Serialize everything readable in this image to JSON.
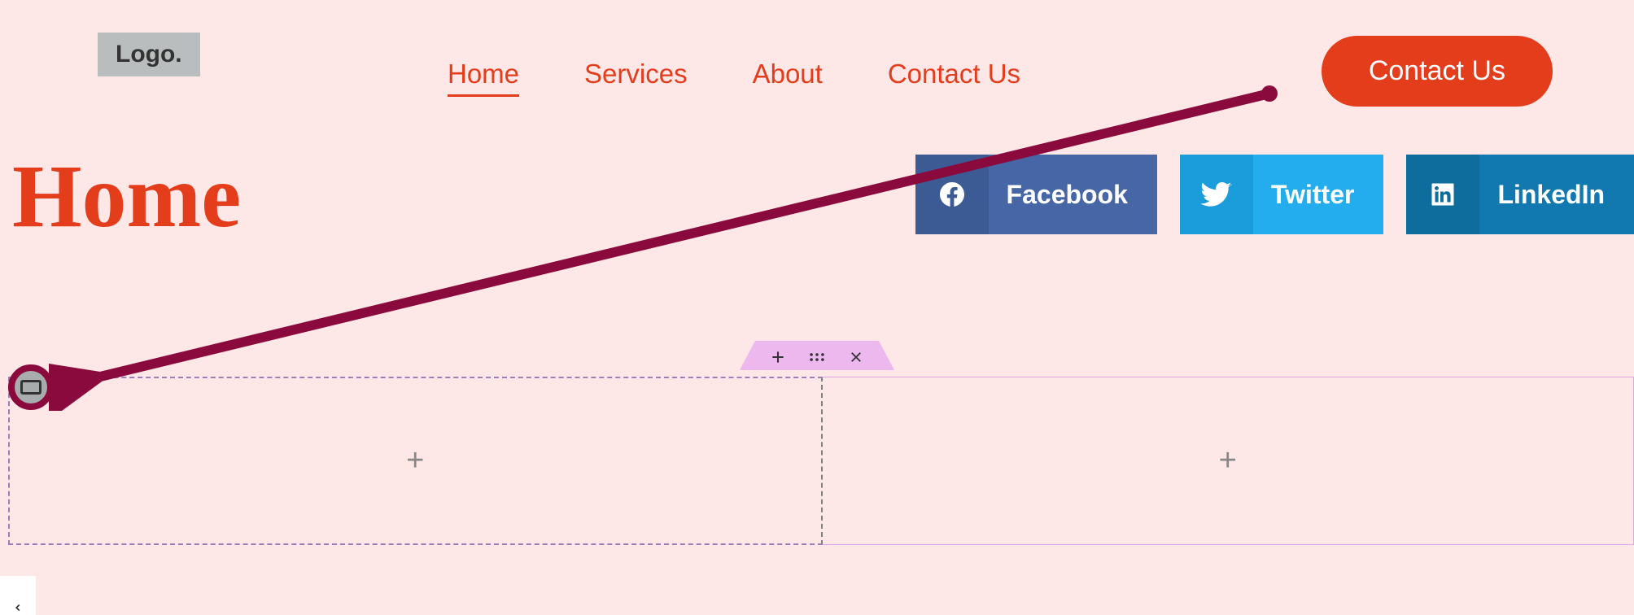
{
  "header": {
    "logo_text": "Logo.",
    "nav_items": [
      "Home",
      "Services",
      "About",
      "Contact Us"
    ],
    "active_nav_index": 0,
    "cta_label": "Contact Us"
  },
  "page": {
    "title": "Home"
  },
  "social": [
    {
      "name": "Facebook",
      "icon": "facebook"
    },
    {
      "name": "Twitter",
      "icon": "twitter"
    },
    {
      "name": "LinkedIn",
      "icon": "linkedin"
    }
  ],
  "editor": {
    "plus_tooltip": "+",
    "drag_tooltip": "⋮⋮⋮",
    "close_tooltip": "×"
  },
  "colors": {
    "accent": "#E43D1C",
    "bg": "#FDE7E7",
    "annotation": "#8B0A3E",
    "facebook": "#4666A5",
    "twitter": "#23ADEE",
    "linkedin": "#1179B0"
  }
}
